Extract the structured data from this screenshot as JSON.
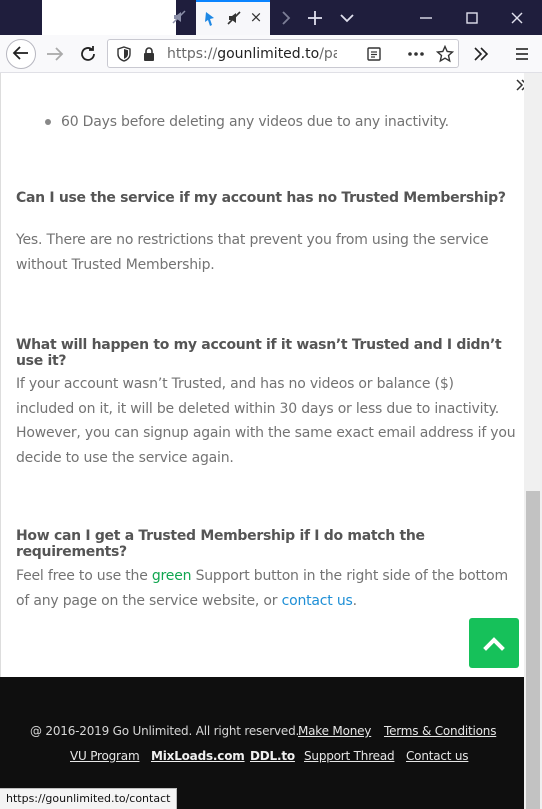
{
  "browser": {
    "url_host": "gounlimited.to",
    "url_prefix": "https://",
    "url_path": "/pag",
    "tab_close": "×",
    "colors": {
      "tab_strip": "#1f1e3d",
      "accent": "#0a84ff"
    }
  },
  "content": {
    "bullet": "60 Days before deleting any videos due to any inactivity.",
    "faq": [
      {
        "q": "Can I use the service if my account has no Trusted Membership?",
        "a": "Yes. There are no restrictions that prevent you from using the service without Trusted Membership."
      },
      {
        "q": "What will happen to my account if it wasn’t Trusted and I didn’t use it?",
        "a": "If your account wasn’t Trusted, and has no videos or balance ($) included on it, it will be deleted within 30 days or less due to inactivity. However, you can signup again with the same exact email address if you decide to use the service again."
      },
      {
        "q": "How can I get a Trusted Membership if I do match the requirements?",
        "a_before": "Feel free to use the ",
        "a_green": "green",
        "a_middle": " Support button in the right side of the bottom of any page on the service website, or ",
        "a_link": "contact us",
        "a_after": "."
      }
    ],
    "colors": {
      "green": "#11a650",
      "link": "#1e8fd6",
      "scroll_button": "#16c15a"
    }
  },
  "footer": {
    "copyright": "@ 2016-2019 Go Unlimited. All right reserved.",
    "row1_links": [
      "Make Money",
      "Terms & Conditions"
    ],
    "row2_links": [
      "VU Program",
      "MixLoads.com",
      "DDL.to",
      "Support Thread",
      "Contact us"
    ]
  },
  "status": {
    "hover_url": "https://gounlimited.to/contact"
  }
}
